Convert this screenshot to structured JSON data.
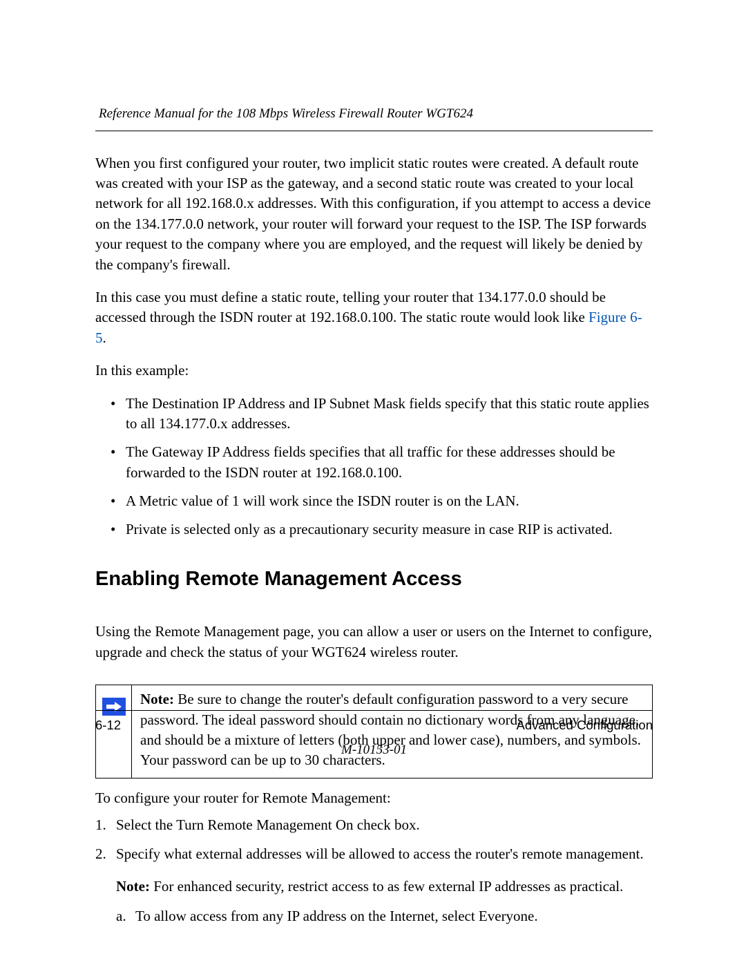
{
  "header": {
    "title": "Reference Manual for the 108 Mbps Wireless Firewall Router WGT624"
  },
  "paragraphs": {
    "p1": "When you first configured your router, two implicit static routes were created. A default route was created with your ISP as the gateway, and a second static route was created to your local network for all 192.168.0.x addresses. With this configuration, if you attempt to access a device on the 134.177.0.0 network, your router will forward your request to the ISP. The ISP forwards your request to the company where you are employed, and the request will likely be denied by the company's firewall.",
    "p2_a": "In this case you must define a static route, telling your router that 134.177.0.0 should be accessed through the ISDN router at 192.168.0.100. The static route would look like ",
    "p2_link": "Figure 6-5",
    "p2_b": ".",
    "p3": "In this example:"
  },
  "bullets": {
    "b1": "The Destination IP Address and IP Subnet Mask fields specify that this static route applies to all 134.177.0.x addresses.",
    "b2": "The Gateway IP Address fields specifies that all traffic for these addresses should be forwarded to the ISDN router at 192.168.0.100.",
    "b3": "A Metric value of 1 will work since the ISDN router is on the LAN.",
    "b4": "Private is selected only as a precautionary security measure in case RIP is activated."
  },
  "section": {
    "heading": "Enabling Remote Management Access",
    "intro": "Using the Remote Management page, you can allow a user or users on the Internet to configure, upgrade and check the status of your WGT624 wireless router."
  },
  "note": {
    "label": "Note:",
    "text": " Be sure to change the router's default configuration password to a very secure password. The ideal password should contain no dictionary words from any language, and should be a mixture of letters (both upper and lower case), numbers, and symbols. Your password can be up to 30 characters."
  },
  "config": {
    "lead": "To configure your router for Remote Management:",
    "item1_num": "1.",
    "item1": "Select the Turn Remote Management On check box.",
    "item2_num": "2.",
    "item2": "Specify what external addresses will be allowed to access the router's remote management.",
    "subnote_label": "Note:",
    "subnote_text": " For enhanced security, restrict access to as few external IP addresses as practical.",
    "sub_a_letter": "a.",
    "sub_a": "To allow access from any IP address on the Internet, select Everyone."
  },
  "footer": {
    "page": "6-12",
    "section": "Advanced Configuration",
    "docid": "M-10153-01"
  }
}
